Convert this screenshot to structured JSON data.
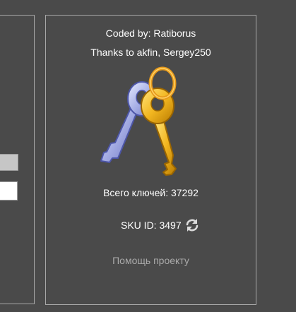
{
  "about": {
    "coded_by": "Coded by: Ratiborus",
    "thanks": "Thanks to akfin, Sergey250",
    "keys_icon": "keys-icon",
    "total_keys": "Всего ключей: 37292",
    "sku_id": "SKU ID: 3497",
    "refresh_icon": "refresh-icon",
    "help_link": "Помощь проекту"
  },
  "colors": {
    "background": "#4a4a4a",
    "border": "#a8a8a8",
    "text": "#ffffff",
    "link": "#a9a9a9"
  }
}
